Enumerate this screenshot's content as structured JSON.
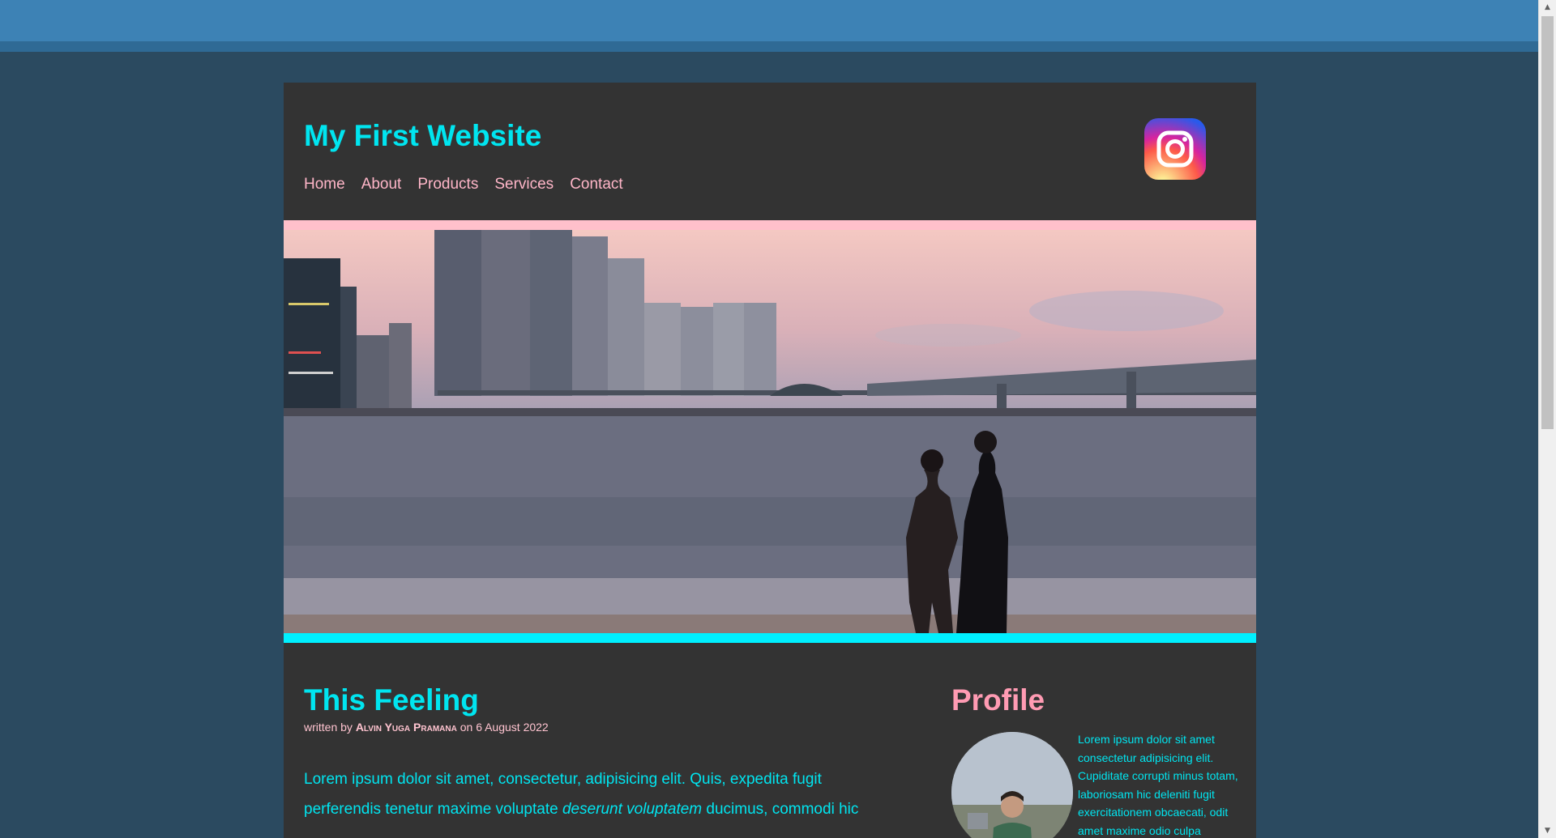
{
  "site": {
    "title": "My First Website"
  },
  "nav": {
    "items": [
      "Home",
      "About",
      "Products",
      "Services",
      "Contact"
    ]
  },
  "social": {
    "icon": "instagram-icon"
  },
  "post": {
    "title": "This Feeling",
    "byline_prefix": "written by",
    "author": "Alvin Yuga Pramana",
    "byline_on": "on",
    "date": "6 August 2022",
    "body_start": "Lorem ipsum dolor sit amet, consectetur, adipisicing elit. Quis, expedita fugit perferendis tenetur maxime voluptate",
    "body_emphasis": "deserunt voluptatem",
    "body_end": "ducimus, commodi hic"
  },
  "profile": {
    "title": "Profile",
    "text": "Lorem ipsum dolor sit amet consectetur adipisicing elit. Cupiditate corrupti minus totam, laboriosam hic deleniti fugit exercitationem obcaecati, odit amet maxime odio culpa"
  },
  "colors": {
    "accent_cyan": "#00e5f0",
    "accent_pink": "#ffb6c8",
    "panel": "#333333",
    "page_bg": "#2b4a60"
  }
}
